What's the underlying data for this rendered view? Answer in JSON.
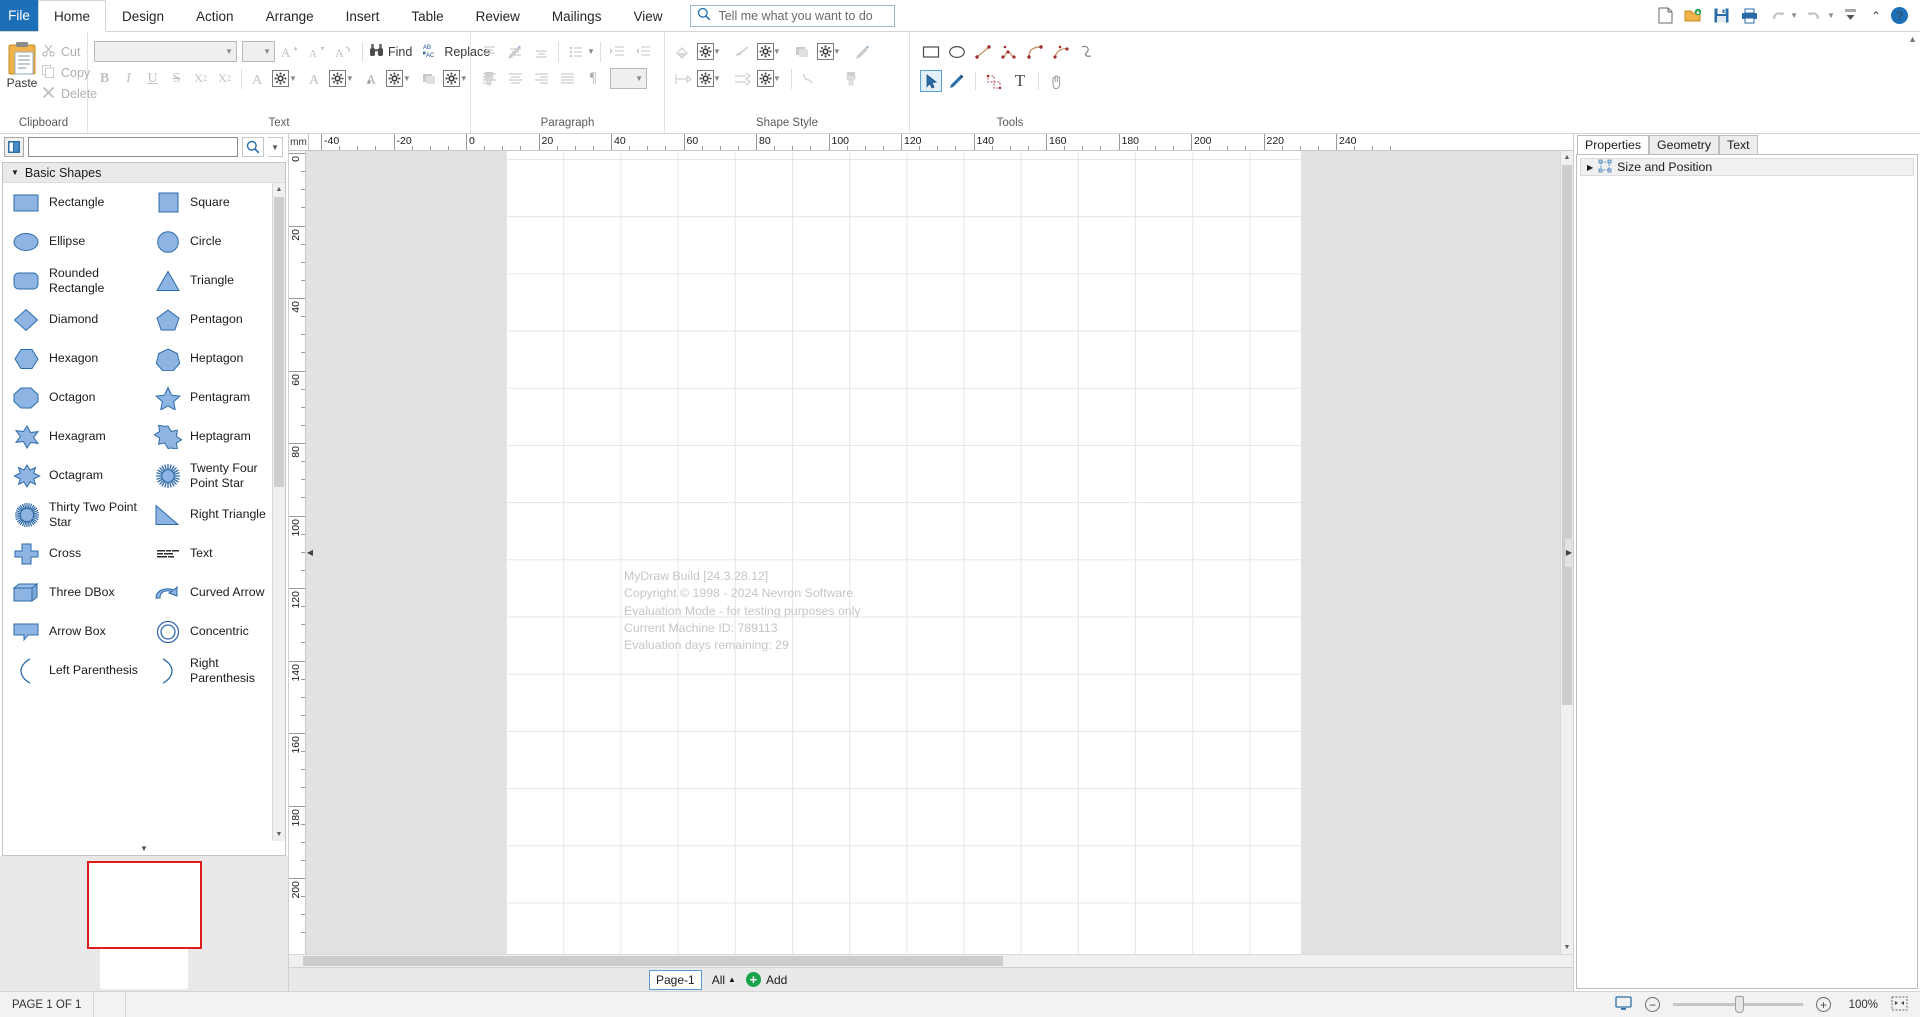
{
  "app": {
    "file_tab": "File",
    "tabs": [
      {
        "label": "Home",
        "active": true
      },
      {
        "label": "Design",
        "active": false
      },
      {
        "label": "Action",
        "active": false
      },
      {
        "label": "Arrange",
        "active": false
      },
      {
        "label": "Insert",
        "active": false
      },
      {
        "label": "Table",
        "active": false
      },
      {
        "label": "Review",
        "active": false
      },
      {
        "label": "Mailings",
        "active": false
      },
      {
        "label": "View",
        "active": false
      }
    ],
    "tellme_placeholder": "Tell me what you want to do",
    "quick_access": [
      "new-icon",
      "open-icon",
      "save-icon",
      "print-icon",
      "undo-icon",
      "redo-icon"
    ],
    "window_controls": [
      "minimize-icon",
      "help-icon"
    ]
  },
  "ribbon": {
    "groups": [
      {
        "title": "Clipboard"
      },
      {
        "title": "Text"
      },
      {
        "title": "Paragraph"
      },
      {
        "title": "Shape Style"
      },
      {
        "title": "Tools"
      }
    ],
    "clipboard": {
      "paste": "Paste",
      "cut": "Cut",
      "copy": "Copy",
      "delete": "Delete"
    },
    "text": {
      "font_value": "",
      "size_value": "",
      "grow_font": "A",
      "shrink_font": "A",
      "clear_format": "A",
      "find": "Find",
      "replace": "Replace",
      "bold": "B",
      "italic": "I",
      "underline": "U",
      "strikethrough": "S",
      "subscript": "X",
      "superscript": "X"
    },
    "paragraph": {
      "line_spacing_value": ""
    }
  },
  "shapes_panel": {
    "search_value": "",
    "search_placeholder": "",
    "library_icon": "library-icon",
    "search_icon": "search-icon",
    "stencil_title": "Basic Shapes",
    "shapes": [
      {
        "label": "Rectangle",
        "icon": "rectangle-shape"
      },
      {
        "label": "Square",
        "icon": "square-shape"
      },
      {
        "label": "Ellipse",
        "icon": "ellipse-shape"
      },
      {
        "label": "Circle",
        "icon": "circle-shape"
      },
      {
        "label": "Rounded Rectangle",
        "icon": "rounded-rectangle-shape"
      },
      {
        "label": "Triangle",
        "icon": "triangle-shape"
      },
      {
        "label": "Diamond",
        "icon": "diamond-shape"
      },
      {
        "label": "Pentagon",
        "icon": "pentagon-shape"
      },
      {
        "label": "Hexagon",
        "icon": "hexagon-shape"
      },
      {
        "label": "Heptagon",
        "icon": "heptagon-shape"
      },
      {
        "label": "Octagon",
        "icon": "octagon-shape"
      },
      {
        "label": "Pentagram",
        "icon": "pentagram-shape"
      },
      {
        "label": "Hexagram",
        "icon": "hexagram-shape"
      },
      {
        "label": "Heptagram",
        "icon": "heptagram-shape"
      },
      {
        "label": "Octagram",
        "icon": "octagram-shape"
      },
      {
        "label": "Twenty Four Point Star",
        "icon": "twenty-four-point-star-shape"
      },
      {
        "label": "Thirty Two Point Star",
        "icon": "thirty-two-point-star-shape"
      },
      {
        "label": "Right Triangle",
        "icon": "right-triangle-shape"
      },
      {
        "label": "Cross",
        "icon": "cross-shape"
      },
      {
        "label": "Text",
        "icon": "text-shape"
      },
      {
        "label": "Three DBox",
        "icon": "three-dbox-shape"
      },
      {
        "label": "Curved Arrow",
        "icon": "curved-arrow-shape"
      },
      {
        "label": "Arrow Box",
        "icon": "arrow-box-shape"
      },
      {
        "label": "Concentric",
        "icon": "concentric-shape"
      },
      {
        "label": "Left Parenthesis",
        "icon": "left-parenthesis-shape"
      },
      {
        "label": "Right Parenthesis",
        "icon": "right-parenthesis-shape"
      }
    ]
  },
  "canvas": {
    "ruler_unit": "mm",
    "h_ticks": [
      "-40",
      "-20",
      "0",
      "20",
      "40",
      "60",
      "80",
      "100",
      "120",
      "140",
      "160",
      "180",
      "200",
      "220",
      "240"
    ],
    "v_ticks": [
      "0",
      "20",
      "40",
      "60",
      "80",
      "100",
      "120",
      "140",
      "160",
      "180",
      "200"
    ],
    "watermark": [
      "MyDraw Build [24.3.28.12]",
      "Copyright © 1998 - 2024 Nevron Software",
      "Evaluation Mode - for testing purposes only",
      "Current Machine ID: 789113",
      "Evaluation days remaining: 29"
    ]
  },
  "pagebar": {
    "page_tab": "Page-1",
    "all_tab": "All",
    "add_tab": "Add"
  },
  "right_panel": {
    "tabs": [
      {
        "label": "Properties",
        "active": true
      },
      {
        "label": "Geometry",
        "active": false
      },
      {
        "label": "Text",
        "active": false
      }
    ],
    "size_and_position": "Size and Position"
  },
  "statusbar": {
    "page_info": "PAGE 1 OF 1",
    "zoom_percent": "100%",
    "fit_icon": "fit-page-icon",
    "monitor_icon": "monitor-icon",
    "zoom_out_icon": "zoom-out-icon",
    "zoom_in_icon": "zoom-in-icon"
  },
  "colors": {
    "accent": "#1d6fb8",
    "shape_fill": "#8db4e2",
    "shape_stroke": "#2e6ba8",
    "green": "#19a34a",
    "red": "#e01b1b"
  }
}
